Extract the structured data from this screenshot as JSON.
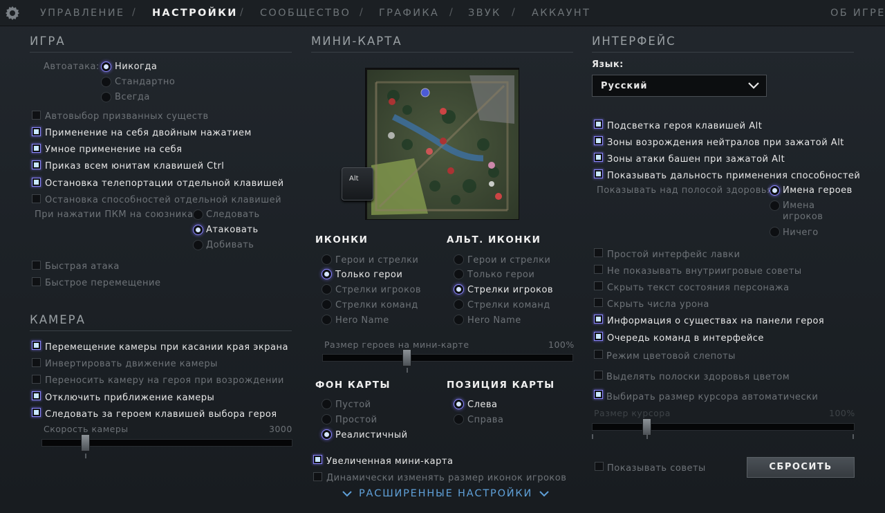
{
  "nav": {
    "tabs": [
      "УПРАВЛЕНИЕ",
      "НАСТРОЙКИ",
      "СООБЩЕСТВО",
      "ГРАФИКА",
      "ЗВУК",
      "АККАУНТ"
    ],
    "active": "НАСТРОЙКИ",
    "about": "ОБ ИГРЕ",
    "separator": "/"
  },
  "game": {
    "title": "ИГРА",
    "autoattack_label": "Автоатака:",
    "autoattack_options": [
      "Никогда",
      "Стандартно",
      "Всегда"
    ],
    "autoattack_selected": "Никогда",
    "checkboxes": [
      {
        "label": "Автовыбор призванных существ",
        "checked": false
      },
      {
        "label": "Применение на себя двойным нажатием",
        "checked": true
      },
      {
        "label": "Умное применение на себя",
        "checked": true
      },
      {
        "label": "Приказ всем юнитам клавишей Ctrl",
        "checked": true
      },
      {
        "label": "Остановка телепортации отдельной клавишей",
        "checked": true
      },
      {
        "label": "Остановка способностей отдельной клавишей",
        "checked": false
      }
    ],
    "rightclick_label": "При нажатии ПКМ на союзника",
    "rightclick_options": [
      "Следовать",
      "Атаковать",
      "Добивать"
    ],
    "rightclick_selected": "Атаковать",
    "checkboxes2": [
      {
        "label": "Быстрая атака",
        "checked": false
      },
      {
        "label": "Быстрое перемещение",
        "checked": false
      }
    ]
  },
  "camera": {
    "title": "КАМЕРА",
    "checkboxes": [
      {
        "label": "Перемещение камеры при касании края экрана",
        "checked": true
      },
      {
        "label": "Инвертировать движение камеры",
        "checked": false
      },
      {
        "label": "Переносить камеру на героя при возрождении",
        "checked": false
      },
      {
        "label": "Отключить приближение камеры",
        "checked": true
      },
      {
        "label": "Следовать за героем клавишей выбора героя",
        "checked": true
      }
    ],
    "speed_label": "Скорость камеры",
    "speed_value": "3000",
    "speed_fraction": 0.17
  },
  "minimap": {
    "title": "МИНИ-КАРТА",
    "alt_key": "Alt",
    "icons_title": "ИКОНКИ",
    "icons_options": [
      "Герои и стрелки",
      "Только герои",
      "Стрелки игроков",
      "Стрелки команд",
      "Hero Name"
    ],
    "icons_selected": "Только герои",
    "alt_icons_title": "АЛЬТ. ИКОНКИ",
    "alt_icons_options": [
      "Герои и стрелки",
      "Только герои",
      "Стрелки игроков",
      "Стрелки команд",
      "Hero Name"
    ],
    "alt_icons_selected": "Стрелки игроков",
    "hero_size_label": "Размер героев на мини-карте",
    "hero_size_value": "100%",
    "hero_size_fraction": 0.34,
    "background_title": "ФОН КАРТЫ",
    "background_options": [
      "Пустой",
      "Простой",
      "Реалистичный"
    ],
    "background_selected": "Реалистичный",
    "position_title": "ПОЗИЦИЯ КАРТЫ",
    "position_options": [
      "Слева",
      "Справа"
    ],
    "position_selected": "Слева",
    "checkboxes": [
      {
        "label": "Увеличенная мини-карта",
        "checked": true
      },
      {
        "label": "Динамически изменять размер иконок игроков",
        "checked": false
      }
    ],
    "advanced": "РАСШИРЕННЫЕ НАСТРОЙКИ"
  },
  "interface": {
    "title": "ИНТЕРФЕЙС",
    "language_label": "Язык:",
    "language_value": "Русский",
    "checkboxes": [
      {
        "label": "Подсветка героя клавишей Alt",
        "checked": true
      },
      {
        "label": "Зоны возрождения нейтралов при зажатой Alt",
        "checked": true
      },
      {
        "label": "Зоны атаки башен при зажатой Alt",
        "checked": true
      },
      {
        "label": "Показывать дальность применения способностей",
        "checked": true
      }
    ],
    "healthbar_label": "Показывать над полосой здоровья:",
    "healthbar_options": [
      "Имена героев",
      "Имена игроков",
      "Ничего"
    ],
    "healthbar_selected": "Имена героев",
    "checkboxes2": [
      {
        "label": "Простой интерфейс лавки",
        "checked": false
      },
      {
        "label": "Не показывать внутриигровые советы",
        "checked": false
      },
      {
        "label": "Скрыть текст состояния персонажа",
        "checked": false
      },
      {
        "label": "Скрыть числа урона",
        "checked": false
      },
      {
        "label": "Информация о существах на панели героя",
        "checked": true
      },
      {
        "label": "Очередь команд в интерфейсе",
        "checked": true
      },
      {
        "label": "Режим цветовой слепоты",
        "checked": false
      },
      {
        "label": "Выделять полоски здоровья цветом",
        "checked": false
      },
      {
        "label": "Выбирать размер курсора автоматически",
        "checked": true
      }
    ],
    "cursor_label": "Размер курсора",
    "cursor_value": "100%",
    "cursor_fraction": 0.2,
    "tips_label": "Показывать советы",
    "tips_checked": false,
    "reset_button": "СБРОСИТЬ"
  },
  "colors": {
    "accent": "#8a86ff",
    "link": "#5fa0d8",
    "background": "#1d2227"
  }
}
